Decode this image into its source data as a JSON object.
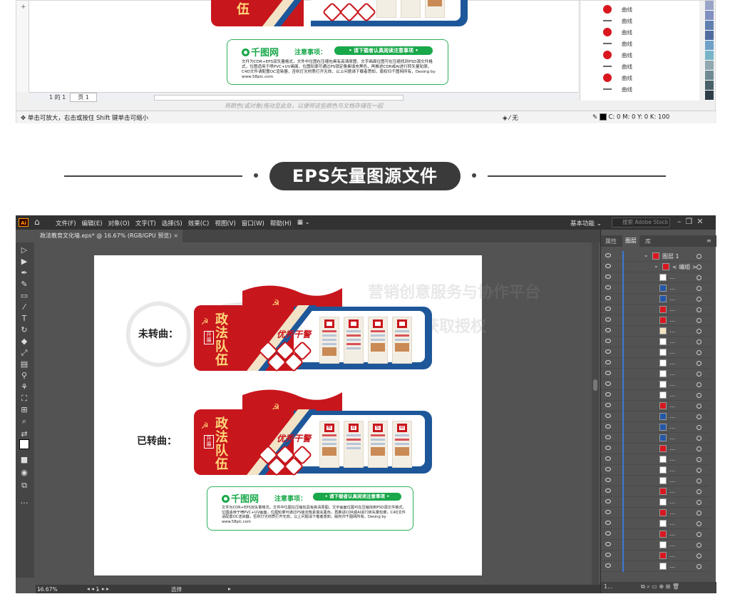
{
  "top_window": {
    "ruler_marks": [
      "+"
    ],
    "status_left": "单击可放大，右击或按住 Shift 键单击可缩小",
    "page_tab": "页 1",
    "page_counter": "1 的 1",
    "hint_text": "将颜色(或对象)拖动至此处，以便将这些颜色与文档存储在一起",
    "fill_label": "无",
    "cmyk_readout": "C: 0 M: 0 Y: 0 K: 100",
    "object_list": [
      {
        "type": "dot",
        "label": "曲线"
      },
      {
        "type": "dash",
        "label": "曲线"
      },
      {
        "type": "dot",
        "label": "曲线"
      },
      {
        "type": "dash",
        "label": "曲线"
      },
      {
        "type": "dash",
        "label": "曲线"
      },
      {
        "type": "dash",
        "label": "曲线"
      },
      {
        "type": "dot",
        "label": "曲线"
      },
      {
        "type": "dash",
        "label": "曲线"
      }
    ],
    "palette_colors": [
      "#9aa4c8",
      "#8090c0",
      "#5f7fb0",
      "#4e6ca0",
      "#6fa0c8",
      "#78b4c8",
      "#90a8b0",
      "#6f8a94",
      "#49606a",
      "#2e3e48"
    ],
    "notice": {
      "logo": "千图网",
      "title": "注意事项：",
      "pill": "• 请下载者认真阅读注意事项 •",
      "body": "文件为CDR+EPS双矢量格式，文件中位图在压缩包具有高清原图，文字画面位图可在压缩找到PSD源文件格式，位图适用于喷PVC+UV画面，位图轮廓可通过PS锁定像素填充黑色，再推进CDR或AI进行转矢量轮廓，C4D文件请配置OC渲染器，否则灯光材质打开无效，以上问题请下载者悉知，版权归千图网所有，Desing by www.58pic.com"
    }
  },
  "section": {
    "heading": "EPS矢量图源文件"
  },
  "illustrator": {
    "app_logo": "Ai",
    "menus": [
      "文件(F)",
      "编辑(E)",
      "对象(O)",
      "文字(T)",
      "选择(S)",
      "效果(C)",
      "视图(V)",
      "窗口(W)",
      "帮助(H)"
    ],
    "workspace": "基本功能",
    "search_placeholder": "搜索 Adobe Stock",
    "doc_tab": "政法教育文化墙.eps* @ 16.67% (RGB/GPU 预览)",
    "zoom": "16.67%",
    "artboard_num": "1",
    "status_tool": "选择",
    "panel_tabs": [
      "属性",
      "图层",
      "库"
    ],
    "layer_name": "图层 1",
    "group_name": "< 编组 >",
    "layer_rows_count": 30,
    "wall_label_uncurved": "未转曲：",
    "wall_label_curved": "已转曲：",
    "wall": {
      "title_chars": [
        "政",
        "法",
        "队",
        "伍"
      ],
      "box_chars": [
        "开",
        "展"
      ],
      "banner": "优秀干警",
      "card_heads": [
        "教",
        "育",
        "整",
        "顿"
      ]
    },
    "watermark_line1": "营销创意服务与协作平台",
    "watermark_line2": "请获取授权",
    "notice": {
      "logo": "千图网",
      "title": "注意事项：",
      "pill": "• 请下载者认真阅读注意事项 •",
      "body": "文件为CDR+EPS双矢量格式，文件中位图在压缩包具有高清原图，文字画面位图可在压缩找到PSD源文件格式，位图适用于喷PVC+UV画面，位图轮廓可通过PS锁定像素填充黑色，再推进CDR或AI进行转矢量轮廓，C4D文件请配置OC渲染器，否则灯光材质打开无效，以上问题请下载者悉知，版权归千图网所有，Desing by www.58pic.com"
    }
  },
  "colors": {
    "red": "#c8161d",
    "blue": "#1e5799",
    "green": "#19a84a",
    "gold": "#ffd87a"
  }
}
